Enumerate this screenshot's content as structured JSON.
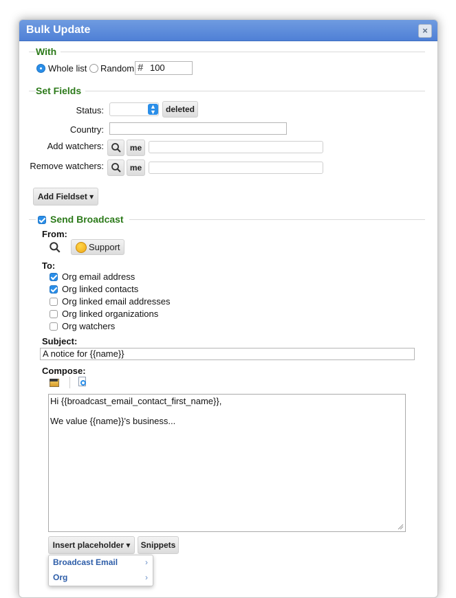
{
  "dialog": {
    "title": "Bulk Update",
    "close_glyph": "×"
  },
  "with": {
    "legend": "With",
    "options": [
      "Whole list",
      "Random"
    ],
    "selected": "Whole list",
    "count_prefix": "#",
    "count_value": "100"
  },
  "set_fields": {
    "legend": "Set Fields",
    "status_label": "Status:",
    "status_button": "deleted",
    "country_label": "Country:",
    "country_value": "",
    "add_watchers_label": "Add watchers:",
    "remove_watchers_label": "Remove watchers:",
    "me_label": "me"
  },
  "add_fieldset": {
    "label": "Add Fieldset ▾"
  },
  "broadcast": {
    "legend": "Send Broadcast",
    "enabled": true,
    "from_label": "From:",
    "from_value": "Support",
    "to_label": "To:",
    "recipients": [
      {
        "label": "Org email address",
        "checked": true
      },
      {
        "label": "Org linked contacts",
        "checked": true
      },
      {
        "label": "Org linked email addresses",
        "checked": false
      },
      {
        "label": "Org linked organizations",
        "checked": false
      },
      {
        "label": "Org watchers",
        "checked": false
      }
    ],
    "subject_label": "Subject:",
    "subject_value": "A notice for {{name}}",
    "compose_label": "Compose:",
    "body_line1": "Hi {{broadcast_email_contact_first_name}},",
    "body_line2": "We value {{name}}'s business...",
    "insert_placeholder_label": "Insert placeholder ▾",
    "snippets_label": "Snippets",
    "placeholder_menu": [
      "Broadcast Email",
      "Org"
    ]
  },
  "colors": {
    "title_bar": "#5a8ad9",
    "legend_green": "#2c7a1a",
    "accent_blue": "#2a8ee8"
  }
}
